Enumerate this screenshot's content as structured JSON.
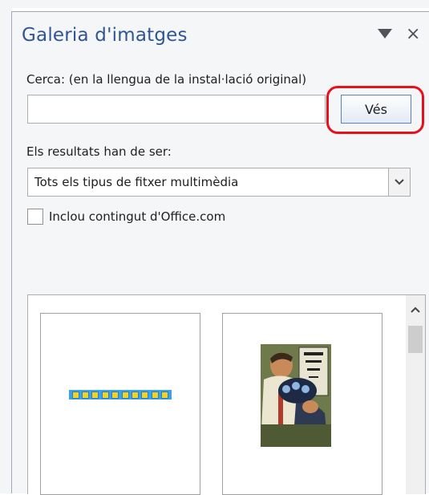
{
  "pane": {
    "title": "Galeria d'imatges",
    "menu_icon": "triangle-down-icon",
    "close_glyph": "×"
  },
  "search": {
    "label": "Cerca: (en la llengua de la instal·lació original)",
    "value": "",
    "button_label": "Vés"
  },
  "results": {
    "label": "Els resultats han de ser:",
    "selected_type": "Tots els tipus de fitxer multimèdia"
  },
  "office_option": {
    "label": "Inclou contingut d'Office.com",
    "checked": false
  },
  "gallery": {
    "items": [
      {
        "icon": "dotted-border-clipart-icon"
      },
      {
        "icon": "eye-exam-clipart-icon"
      }
    ]
  },
  "colors": {
    "title": "#2f5597",
    "highlight": "#e8101a",
    "button_border": "#5a82b8"
  }
}
